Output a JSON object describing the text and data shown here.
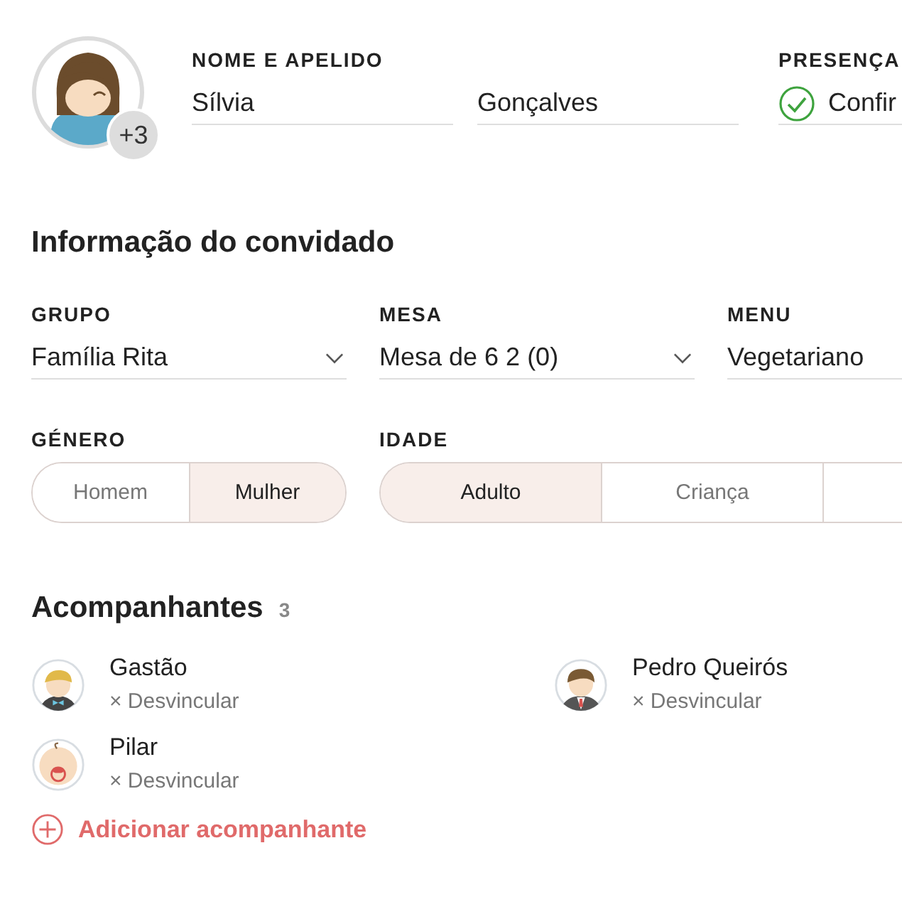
{
  "guest": {
    "extra_badge": "+3",
    "name_label": "NOME E APELIDO",
    "first_name": "Sílvia",
    "last_name": "Gonçalves",
    "presence_label": "PRESENÇA",
    "presence_value": "Confir",
    "presence_confirmed": true
  },
  "section_title": "Informação do convidado",
  "selects": [
    {
      "label": "GRUPO",
      "value": "Família Rita",
      "dropdown": true
    },
    {
      "label": "MESA",
      "value": "Mesa de 6 2 (0)",
      "dropdown": true
    },
    {
      "label": "MENU",
      "value": "Vegetariano"
    }
  ],
  "gender": {
    "label": "GÉNERO",
    "options": [
      {
        "label": "Homem",
        "selected": false
      },
      {
        "label": "Mulher",
        "selected": true
      }
    ]
  },
  "age": {
    "label": "IDADE",
    "options": [
      {
        "label": "Adulto",
        "selected": true
      },
      {
        "label": "Criança",
        "selected": false
      }
    ]
  },
  "companions": {
    "title": "Acompanhantes",
    "count": "3",
    "items": [
      {
        "name": "Gastão",
        "kind": "boy",
        "unlink": "× Desvincular"
      },
      {
        "name": "Pedro Queirós",
        "kind": "man",
        "unlink": "× Desvincular"
      },
      {
        "name": "Pilar",
        "kind": "baby",
        "unlink": "× Desvincular"
      }
    ],
    "add_label": "Adicionar acompanhante"
  }
}
